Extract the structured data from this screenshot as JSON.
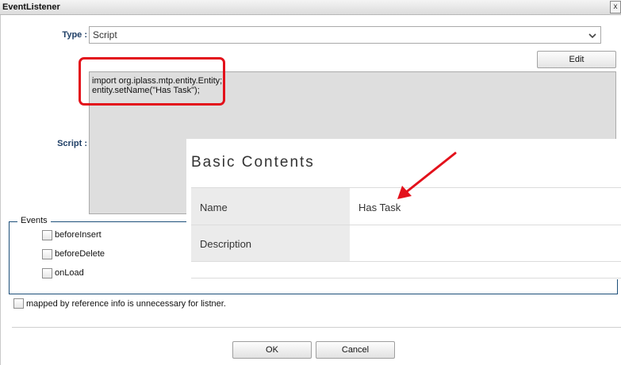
{
  "window": {
    "title": "EventListener",
    "close_label": "x"
  },
  "type_field": {
    "label": "Type :",
    "value": "Script"
  },
  "script_field": {
    "label": "Script :",
    "edit_label": "Edit",
    "lines": [
      "import org.iplass.mtp.entity.Entity;",
      "entity.setName(\"Has Task\");"
    ]
  },
  "events": {
    "legend": "Events",
    "items": [
      {
        "label": "beforeInsert",
        "checked": false
      },
      {
        "label": "beforeDelete",
        "checked": false
      },
      {
        "label": "onLoad",
        "checked": false
      }
    ]
  },
  "mapped_ref": {
    "label": "mapped by reference info is unnecessary for listner.",
    "checked": false
  },
  "overlay": {
    "title": "Basic Contents",
    "rows": [
      {
        "label": "Name",
        "value": "Has Task"
      },
      {
        "label": "Description",
        "value": ""
      }
    ]
  },
  "footer": {
    "ok_label": "OK",
    "cancel_label": "Cancel"
  },
  "colors": {
    "annotation_red": "#e3111b",
    "label_navy": "#1f3f66",
    "fieldset_border": "#1d4f7a",
    "script_bg": "#dedede"
  }
}
